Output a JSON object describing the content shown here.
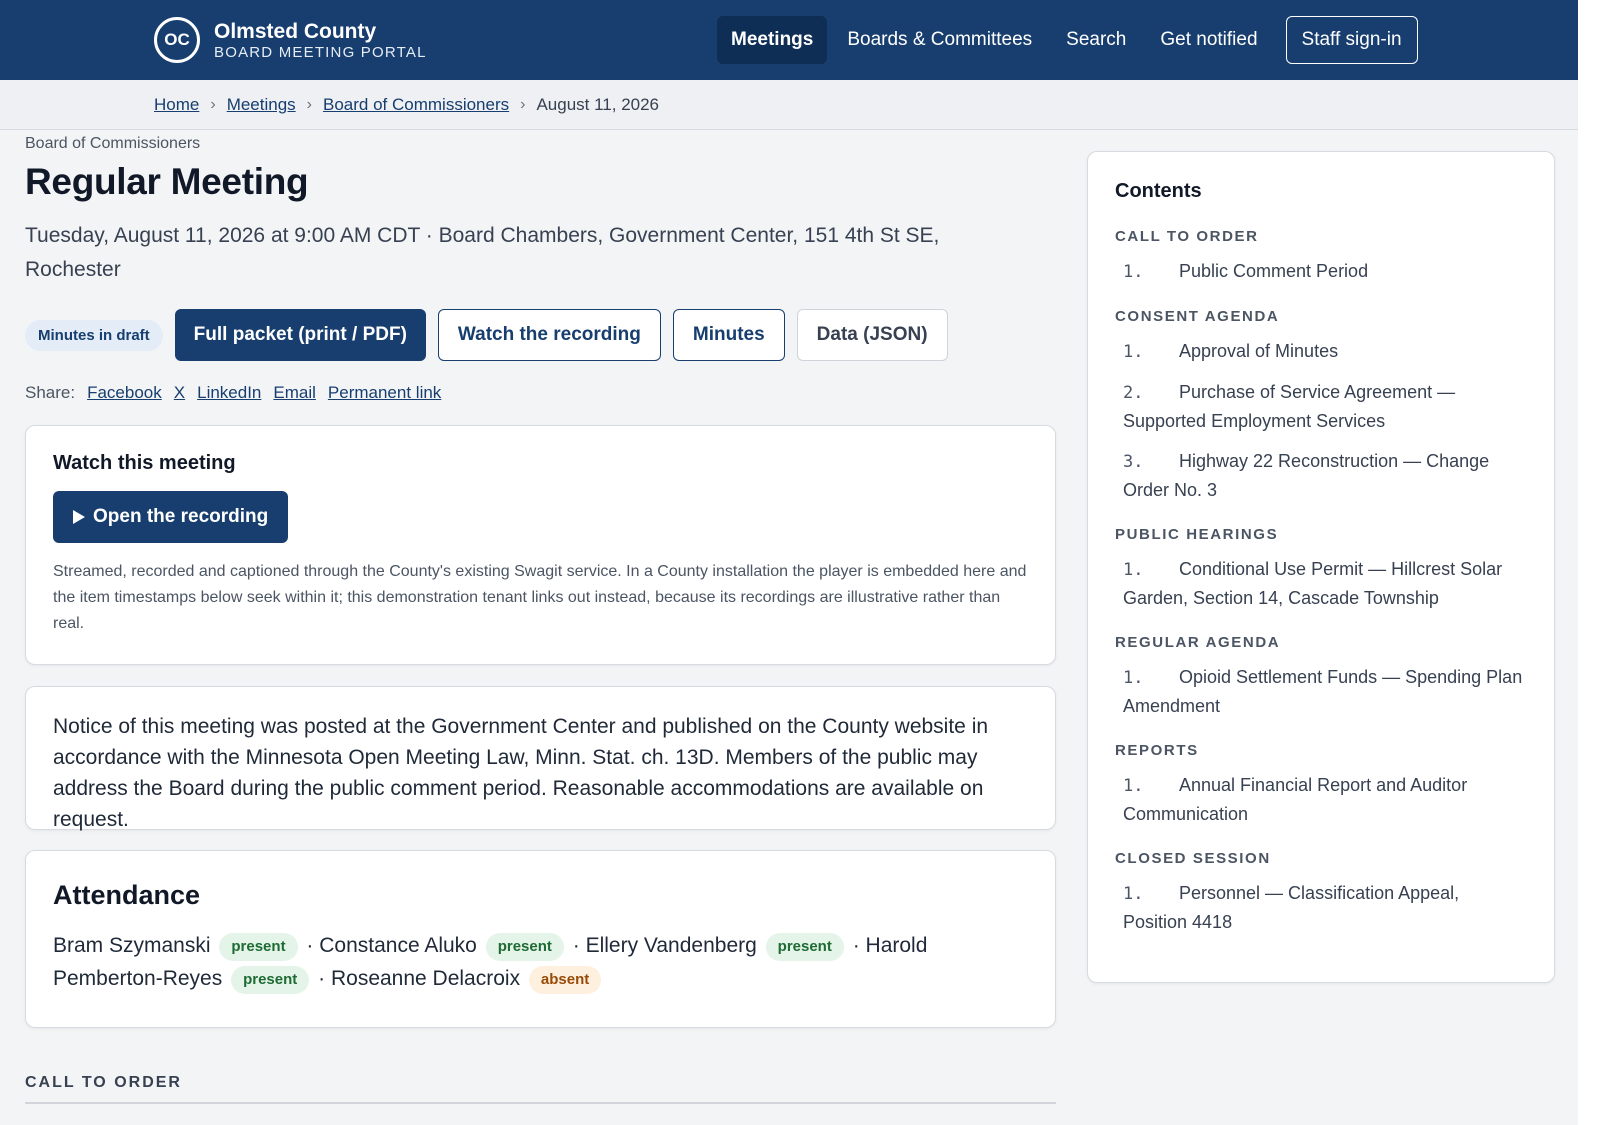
{
  "header": {
    "logo_mark": "OC",
    "brand_name": "Olmsted County",
    "brand_sub": "BOARD MEETING PORTAL",
    "nav": [
      "Meetings",
      "Boards & Committees",
      "Search",
      "Get notified"
    ],
    "signin": "Staff sign-in"
  },
  "breadcrumb": {
    "items": [
      "Home",
      "Meetings",
      "Board of Commissioners"
    ],
    "current": "August 11, 2026"
  },
  "meeting": {
    "eyebrow": "Board of Commissioners",
    "title": "Regular Meeting",
    "when": "Tuesday, August 11, 2026 at 9:00 AM CDT · Board Chambers, Government Center, 151 4th St SE, Rochester",
    "status_chip": "Minutes in draft",
    "buttons": {
      "packet": "Full packet (print / PDF)",
      "recording": "Watch the recording",
      "minutes": "Minutes",
      "data": "Data (JSON)"
    },
    "share_label": "Share:",
    "share_links": [
      "Facebook",
      "X",
      "LinkedIn",
      "Email",
      "Permanent link"
    ]
  },
  "watch": {
    "title": "Watch this meeting",
    "button": "Open the recording",
    "note": "Streamed, recorded and captioned through the County's existing Swagit service. In a County installation the player is embedded here and the item timestamps below seek within it; this demonstration tenant links out instead, because its recordings are illustrative rather than real."
  },
  "notice": "Notice of this meeting was posted at the Government Center and published on the County website in accordance with the Minnesota Open Meeting Law, Minn. Stat. ch. 13D. Members of the public may address the Board during the public comment period. Reasonable accommodations are available on request.",
  "attendance": {
    "title": "Attendance",
    "separator": "·",
    "members": [
      {
        "name": "Bram Szymanski",
        "status": "present"
      },
      {
        "name": "Constance Aluko",
        "status": "present"
      },
      {
        "name": "Ellery Vandenberg",
        "status": "present"
      },
      {
        "name": "Harold Pemberton-Reyes",
        "status": "present"
      },
      {
        "name": "Roseanne Delacroix",
        "status": "absent"
      }
    ]
  },
  "agenda_section_heading": "CALL TO ORDER",
  "toc": {
    "title": "Contents",
    "sections": [
      {
        "heading": "CALL TO ORDER",
        "items": [
          {
            "num": "1.",
            "label": "Public Comment Period"
          }
        ]
      },
      {
        "heading": "CONSENT AGENDA",
        "items": [
          {
            "num": "1.",
            "label": "Approval of Minutes"
          },
          {
            "num": "2.",
            "label": "Purchase of Service Agreement — Supported Employment Services"
          },
          {
            "num": "3.",
            "label": "Highway 22 Reconstruction — Change Order No. 3"
          }
        ]
      },
      {
        "heading": "PUBLIC HEARINGS",
        "items": [
          {
            "num": "1.",
            "label": "Conditional Use Permit — Hillcrest Solar Garden, Section 14, Cascade Township"
          }
        ]
      },
      {
        "heading": "REGULAR AGENDA",
        "items": [
          {
            "num": "1.",
            "label": "Opioid Settlement Funds — Spending Plan Amendment"
          }
        ]
      },
      {
        "heading": "REPORTS",
        "items": [
          {
            "num": "1.",
            "label": "Annual Financial Report and Auditor Communication"
          }
        ]
      },
      {
        "heading": "CLOSED SESSION",
        "items": [
          {
            "num": "1.",
            "label": "Personnel — Classification Appeal, Position 4418"
          }
        ]
      }
    ]
  }
}
